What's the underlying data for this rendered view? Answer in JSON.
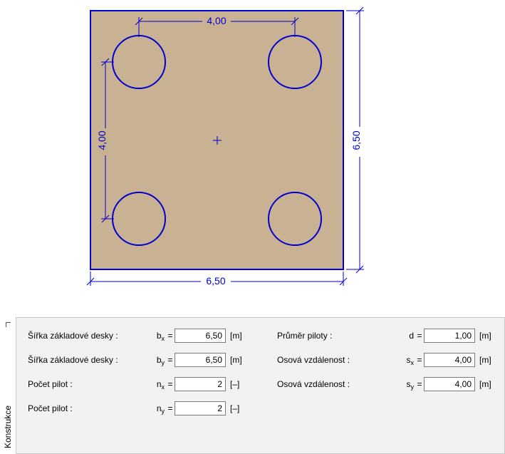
{
  "drawing": {
    "outer_width_label": "6,50",
    "outer_height_label": "6,50",
    "inner_spacing_x_label": "4,00",
    "inner_spacing_y_label": "4,00"
  },
  "panel_title": "Konstrukce",
  "left": {
    "bx": {
      "label": "Šířka základové desky :",
      "value": "6,50",
      "unit": "[m]"
    },
    "by": {
      "label": "Šířka základové desky :",
      "value": "6,50",
      "unit": "[m]"
    },
    "nx": {
      "label": "Počet pilot :",
      "value": "2",
      "unit": "[–]"
    },
    "ny": {
      "label": "Počet pilot :",
      "value": "2",
      "unit": "[–]"
    }
  },
  "right": {
    "d": {
      "label": "Průměr piloty :",
      "value": "1,00",
      "unit": "[m]"
    },
    "sx": {
      "label": "Osová vzdálenost :",
      "value": "4,00",
      "unit": "[m]"
    },
    "sy": {
      "label": "Osová vzdálenost :",
      "value": "4,00",
      "unit": "[m]"
    }
  }
}
